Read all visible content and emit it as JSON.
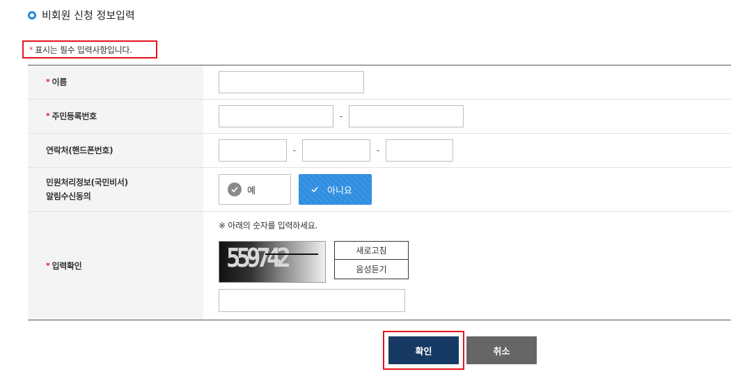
{
  "section": {
    "title": "비회원 신청 정보입력",
    "icon": "circle-bullet-icon"
  },
  "required_note": {
    "star": "*",
    "text": "표시는 필수 입력사항입니다."
  },
  "fields": {
    "name": {
      "label": "이름",
      "required": true
    },
    "rrn": {
      "label": "주민등록번호",
      "required": true,
      "separator": "-"
    },
    "phone": {
      "label": "연락처(핸드폰번호)",
      "required": false,
      "separator": "-"
    },
    "consent": {
      "label_line1": "민원처리정보(국민비서)",
      "label_line2": "알림수신동의",
      "option_yes": "예",
      "option_no": "아니요",
      "selected": "아니요"
    },
    "captcha": {
      "label": "입력확인",
      "required": true,
      "guide": "※ 아래의 숫자를 입력하세요.",
      "image_text": "559742",
      "refresh_label": "새로고침",
      "audio_label": "음성듣기"
    }
  },
  "actions": {
    "ok_label": "확인",
    "cancel_label": "취소"
  },
  "colors": {
    "accent": "#2f8ee0",
    "required": "#e4141b",
    "ok": "#173a64",
    "cancel": "#666666"
  }
}
